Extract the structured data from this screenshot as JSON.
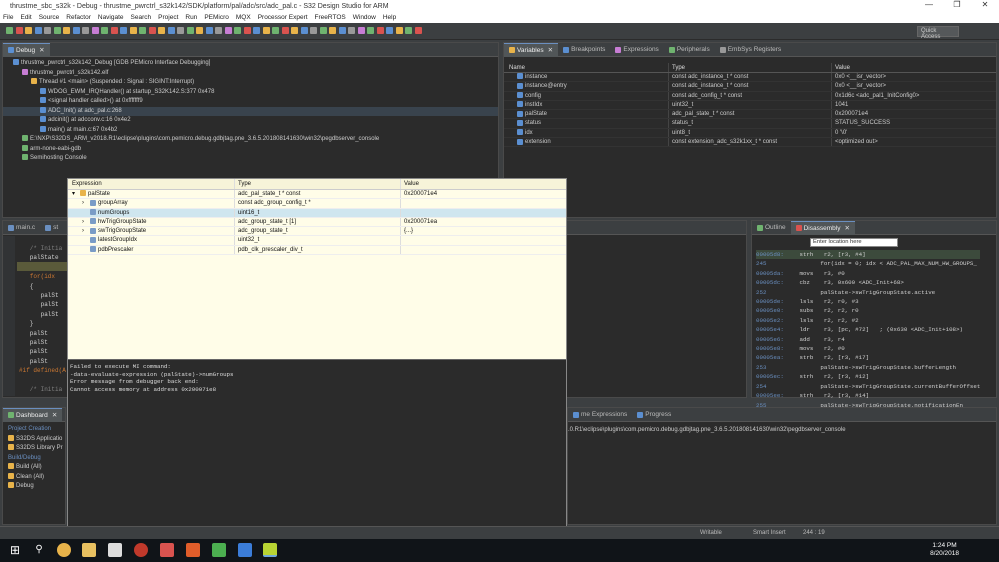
{
  "window": {
    "title": "thrustme_sbc_s32k - Debug - thrustme_pwrctrl_s32k142/SDK/platform/pal/adc/src/adc_pal.c - S32 Design Studio for ARM",
    "minimize": "—",
    "maximize": "❐",
    "close": "✕"
  },
  "menu": [
    "File",
    "Edit",
    "Source",
    "Refactor",
    "Navigate",
    "Search",
    "Project",
    "Run",
    "PEMicro",
    "MQX",
    "Processor Expert",
    "FreeRTOS",
    "Window",
    "Help"
  ],
  "toolbar": {
    "quick_access": "Quick Access"
  },
  "debug": {
    "tab": "Debug",
    "tree": [
      {
        "text": "thrustme_pwrctrl_s32k142_Debug [GDB PEMicro Interface Debugging]",
        "indent": 0,
        "icon": "#5b8fd1"
      },
      {
        "text": "thrustme_pwrctrl_s32k142.elf",
        "indent": 1,
        "icon": "#c77dd4"
      },
      {
        "text": "Thread #1 <main> (Suspended : Signal : SIGINT:Interrupt)",
        "indent": 2,
        "icon": "#e8b34a"
      },
      {
        "text": "WDOG_EWM_IRQHandler() at startup_S32K142.S:377 0x478",
        "indent": 3,
        "icon": "#5b8fd1"
      },
      {
        "text": "<signal handler called>() at 0xfffffff9",
        "indent": 3,
        "icon": "#5b8fd1"
      },
      {
        "text": "ADC_Init() at adc_pal.c:268",
        "indent": 3,
        "icon": "#5b8fd1"
      },
      {
        "text": "adcinit() at adcconv.c:16 0x4e2",
        "indent": 3,
        "icon": "#5b8fd1"
      },
      {
        "text": "main() at main.c:67 0x4b2",
        "indent": 3,
        "icon": "#5b8fd1"
      },
      {
        "text": "E:\\NXP\\S32DS_ARM_v2018.R1\\eclipse\\plugins\\com.pemicro.debug.gdbjtag.pne_3.6.5.201808141630\\win32\\pegdbserver_console",
        "indent": 1,
        "icon": "#6fb36f"
      },
      {
        "text": "arm-none-eabi-gdb",
        "indent": 1,
        "icon": "#6fb36f"
      },
      {
        "text": "Semihosting Console",
        "indent": 1,
        "icon": "#6fb36f"
      }
    ]
  },
  "variables": {
    "tabs": [
      {
        "label": "Variables",
        "active": true
      },
      {
        "label": "Breakpoints",
        "active": false
      },
      {
        "label": "Expressions",
        "active": false
      },
      {
        "label": "Peripherals",
        "active": false
      },
      {
        "label": "EmbSys Registers",
        "active": false
      }
    ],
    "columns": [
      "Name",
      "Type",
      "Value"
    ],
    "rows": [
      {
        "name": "instance",
        "type": "const adc_instance_t * const",
        "value": "0x0 <__isr_vector>"
      },
      {
        "name": "instance@entry",
        "type": "const adc_instance_t * const",
        "value": "0x0 <__isr_vector>"
      },
      {
        "name": "config",
        "type": "const adc_config_t * const",
        "value": "0x1d6c <adc_pal1_InitConfig0>"
      },
      {
        "name": "instIdx",
        "type": "uint32_t",
        "value": "1041"
      },
      {
        "name": "palState",
        "type": "adc_pal_state_t * const",
        "value": "0x200071e4"
      },
      {
        "name": "status",
        "type": "status_t",
        "value": "STATUS_SUCCESS"
      },
      {
        "name": "idx",
        "type": "uint8_t",
        "value": "0 '\\0'"
      },
      {
        "name": "extension",
        "type": "const extension_adc_s32k1xx_t * const",
        "value": "<optimized out>"
      }
    ]
  },
  "hover": {
    "columns": [
      "Expression",
      "Type",
      "Value"
    ],
    "rows": [
      {
        "expr": "palState",
        "type": "adc_pal_state_t * const",
        "value": "0x200071e4",
        "indent": 0,
        "toggle": "▾"
      },
      {
        "expr": "groupArray",
        "type": "const adc_group_config_t *",
        "value": "",
        "indent": 1,
        "toggle": "›"
      },
      {
        "expr": "numGroups",
        "type": "uint16_t",
        "value": "",
        "indent": 1,
        "toggle": "",
        "selected": true
      },
      {
        "expr": "hwTrigGroupState",
        "type": "adc_group_state_t [1]",
        "value": "0x200071ea",
        "indent": 1,
        "toggle": "›"
      },
      {
        "expr": "swTrigGroupState",
        "type": "adc_group_state_t",
        "value": "{...}",
        "indent": 1,
        "toggle": "›"
      },
      {
        "expr": "latestGroupIdx",
        "type": "uint32_t",
        "value": "",
        "indent": 1,
        "toggle": ""
      },
      {
        "expr": "pdbPrescaler",
        "type": "pdb_clk_prescaler_div_t",
        "value": "",
        "indent": 1,
        "toggle": ""
      }
    ],
    "error": "Failed to execute MI command:\n-data-evaluate-expression (palState)->numGroups\nError message from debugger back end:\nCannot access memory at address 0x200071e8"
  },
  "editor": {
    "tabs": [
      {
        "label": "main.c"
      },
      {
        "label": "st"
      }
    ],
    "lines": [
      {
        "text": "   /* Initia",
        "cls": "cm"
      },
      {
        "text": "   palState",
        "cls": ""
      },
      {
        "text": "",
        "cls": ""
      },
      {
        "text": "   for(idx ",
        "cls": "kw"
      },
      {
        "text": "   {",
        "cls": ""
      },
      {
        "text": "      palSt",
        "cls": ""
      },
      {
        "text": "      palSt",
        "cls": ""
      },
      {
        "text": "      palSt",
        "cls": ""
      },
      {
        "text": "   }",
        "cls": ""
      },
      {
        "text": "   palSt",
        "cls": ""
      },
      {
        "text": "   palSt",
        "cls": ""
      },
      {
        "text": "   palSt",
        "cls": ""
      },
      {
        "text": "   palSt",
        "cls": ""
      },
      {
        "text": "#if defined(A",
        "cls": "kw"
      },
      {
        "text": "",
        "cls": ""
      },
      {
        "text": "   /* Initia",
        "cls": "cm"
      }
    ]
  },
  "disassembly": {
    "tabs": [
      {
        "label": "Outline",
        "active": false
      },
      {
        "label": "Disassembly",
        "active": true
      }
    ],
    "location_placeholder": "Enter location here",
    "lines": [
      {
        "addr": "00005d8:",
        "text": " strh   r2, [r3, #4]"
      },
      {
        "addr": "245",
        "text": "       for(idx = 0; idx < ADC_PAL_MAX_NUM_HW_GROUPS_"
      },
      {
        "addr": "00005da:",
        "text": " movs   r3, #0"
      },
      {
        "addr": "00005dc:",
        "text": " cbz    r3, 0x600 <ADC_Init+68>"
      },
      {
        "addr": "252",
        "text": "       palState->swTrigGroupState.active"
      },
      {
        "addr": "00005de:",
        "text": " lsls   r2, r0, #3"
      },
      {
        "addr": "00005e0:",
        "text": " subs   r2, r2, r0"
      },
      {
        "addr": "00005e2:",
        "text": " lsls   r2, r2, #2"
      },
      {
        "addr": "00005e4:",
        "text": " ldr    r3, [pc, #72]   ; (0x630 <ADC_Init+108>)"
      },
      {
        "addr": "00005e6:",
        "text": " add    r3, r4"
      },
      {
        "addr": "00005e8:",
        "text": " movs   r2, #0"
      },
      {
        "addr": "00005ea:",
        "text": " strb   r2, [r3, #17]"
      },
      {
        "addr": "253",
        "text": "       palState->swTrigGroupState.bufferLength"
      },
      {
        "addr": "00005ec:",
        "text": " strh   r2, [r3, #12]"
      },
      {
        "addr": "254",
        "text": "       palState->swTrigGroupState.currentBufferOffset"
      },
      {
        "addr": "00005ee:",
        "text": " strh   r2, [r3, #14]"
      },
      {
        "addr": "255",
        "text": "       palState->swTrigGroupState.notificationEn"
      },
      {
        "addr": "00005f0:",
        "text": " strb   r2, [r3, #16]"
      }
    ]
  },
  "dashboard": {
    "tab": "Dashboard",
    "tab2": "St",
    "sections": [
      {
        "title": "Project Creation",
        "items": [
          "S32DS Applicatio",
          "S32DS Library Pr"
        ]
      },
      {
        "title": "Build/Debug",
        "items": [
          "Build  (All)",
          "Clean  (All)",
          "Debug"
        ]
      }
    ]
  },
  "console": {
    "tabs": [
      {
        "label": "me Expressions"
      },
      {
        "label": "Progress"
      }
    ],
    "text": ".0.R1\\eclipse\\plugins\\com.pemicro.debug.gdbjtag.pne_3.6.5.201808141630\\win32\\pegdbserver_console"
  },
  "status": {
    "writable": "Writable",
    "insert": "Smart Insert",
    "position": "244 : 19"
  },
  "clock": {
    "time": "1:24 PM",
    "date": "8/20/2018"
  }
}
